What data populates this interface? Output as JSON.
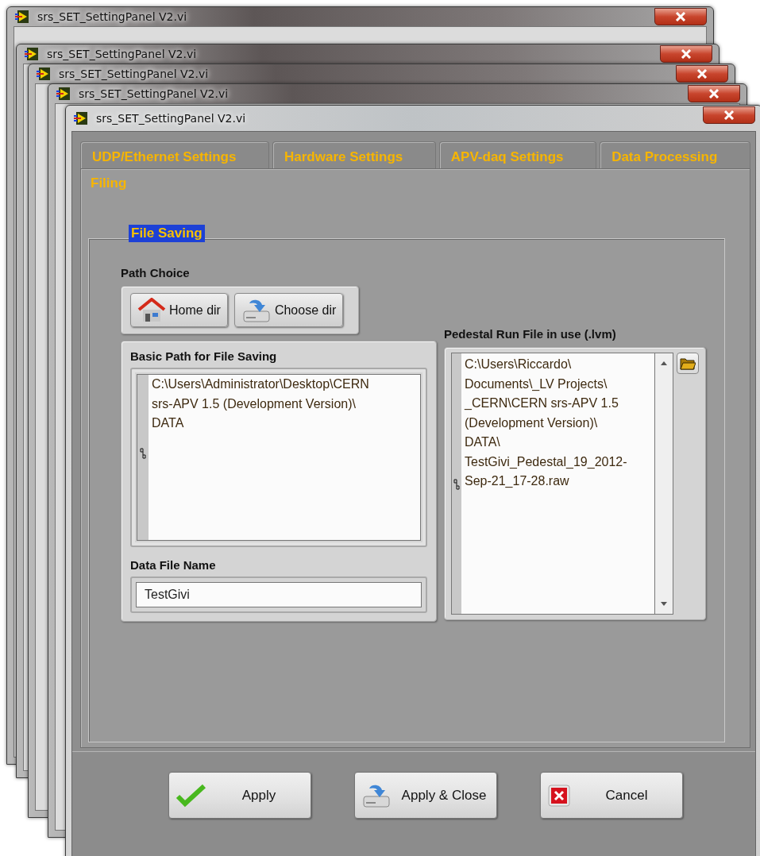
{
  "background_windows": [
    {
      "title": "srs_SET_SettingPanel V2.vi"
    },
    {
      "title": "srs_SET_SettingPanel V2.vi"
    },
    {
      "title": "srs_SET_SettingPanel V2.vi"
    },
    {
      "title": "srs_SET_SettingPanel V2.vi"
    }
  ],
  "window": {
    "title": "srs_SET_SettingPanel V2.vi"
  },
  "tabs": [
    {
      "label": "UDP/Ethernet Settings",
      "selected": false
    },
    {
      "label": "Hardware Settings",
      "selected": false
    },
    {
      "label": "APV-daq Settings",
      "selected": false
    },
    {
      "label": "Data Processing",
      "selected": false
    },
    {
      "label": "Filing",
      "selected": true
    }
  ],
  "group": {
    "title": "File Saving"
  },
  "path_choice": {
    "label": "Path Choice",
    "buttons": [
      {
        "kind": "home",
        "label": "Home dir"
      },
      {
        "kind": "choose",
        "label": "Choose dir"
      }
    ]
  },
  "basic_path": {
    "label": "Basic Path for File Saving",
    "value": "C:\\Users\\Administrator\\Desktop\\CERN\nsrs-APV 1.5 (Development Version)\\\nDATA"
  },
  "data_file_name": {
    "label": "Data File Name",
    "value": "TestGivi"
  },
  "pedestal_file": {
    "label": "Pedestal Run File in use (.lvm)",
    "value": "C:\\Users\\Riccardo\\\nDocuments\\_LV Projects\\\n_CERN\\CERN srs-APV 1.5\n(Development Version)\\\nDATA\\\nTestGivi_Pedestal_19_2012-\nSep-21_17-28.raw"
  },
  "buttons": [
    {
      "kind": "apply",
      "label": "Apply"
    },
    {
      "kind": "apply_close",
      "label": "Apply & Close"
    },
    {
      "kind": "cancel",
      "label": "Cancel"
    }
  ]
}
